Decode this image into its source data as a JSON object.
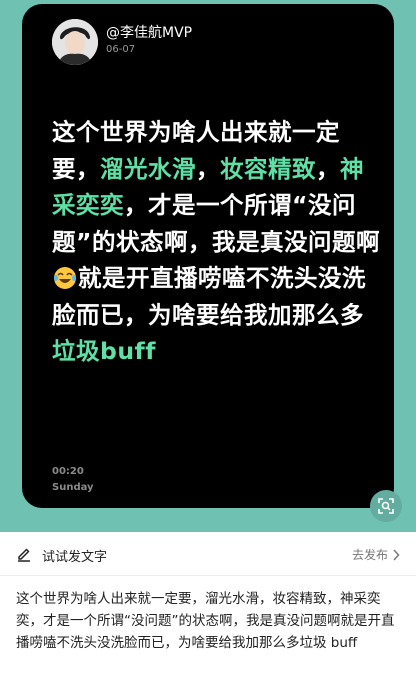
{
  "post": {
    "username": "@李佳航MVP",
    "date": "06-07",
    "time": "00:20",
    "weekday": "Sunday",
    "text_parts": [
      "这个世界为啥人出来就一定要，",
      "溜光水滑",
      "，",
      "妆容精致",
      "，",
      "神采奕奕",
      "，才是一个所谓“没问题”的状态啊，我是真没问题啊",
      "就是开直播唠嗑不洗头没洗脸而已，为啥要给我加那么多",
      "垃圾buff"
    ],
    "highlight_color": "#5fe0a6",
    "emoji_icon": "laughing-crying-emoji-icon"
  },
  "action_bar": {
    "try_label": "试试发文字",
    "publish_label": "去发布",
    "edit_icon": "edit-pen-icon",
    "arrow_icon": "chevron-right-icon"
  },
  "caption": "这个世界为啥人出来就一定要，溜光水滑，妆容精致，神采奕奕，才是一个所谓“没问题”的状态啊，我是真没问题啊就是开直播唠嗑不洗头没洗脸而已，为啥要给我加那么多垃圾 buff",
  "colors": {
    "background_teal": "#6fc1b2",
    "card_bg": "#000000",
    "text_white": "#ffffff"
  }
}
